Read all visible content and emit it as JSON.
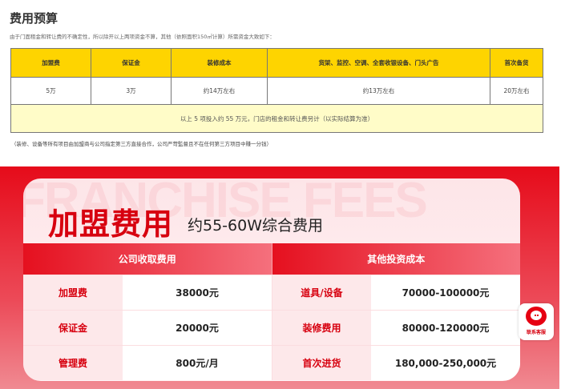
{
  "title": "费用预算",
  "description": "由于门面租金和转让费的不确定性，所以除开以上两项资金不算，其他（依照面积150㎡计算）所需资金大致如下：",
  "budget_table": {
    "headers": [
      "加盟费",
      "保证金",
      "装修成本",
      "货架、监控、空调、全套收银设备、门头广告",
      "首次备货"
    ],
    "values": [
      "5万",
      "3万",
      "约14万左右",
      "约13万左右",
      "20万左右"
    ],
    "summary": "以上 5 项投入约 55 万元，门店的租金和转让费另计（以实际结算为准）"
  },
  "note": "（装修、设备等所有项目由加盟商与公司指定第三方直接合作，公司严苛監督且不在任何第三方项目中赚一分钱）",
  "fee_card": {
    "watermark": "FRANCHISE FEES",
    "title": "加盟费用",
    "subtitle": "约55-60W综合费用",
    "columns": [
      "公司收取费用",
      "其他投资成本"
    ],
    "rows": [
      {
        "l1": "加盟费",
        "v1": "38000元",
        "l2": "道具/设备",
        "v2": "70000-100000元"
      },
      {
        "l1": "保证金",
        "v1": "20000元",
        "l2": "装修费用",
        "v2": "80000-120000元"
      },
      {
        "l1": "管理费",
        "v1": "800元/月",
        "l2": "首次进货",
        "v2": "180,000-250,000元"
      }
    ]
  },
  "chat_widget": {
    "label": "联系客服",
    "icon": "chat-bubble-icon"
  },
  "colors": {
    "yellow": "#fed400",
    "red": "#e60b1a"
  }
}
